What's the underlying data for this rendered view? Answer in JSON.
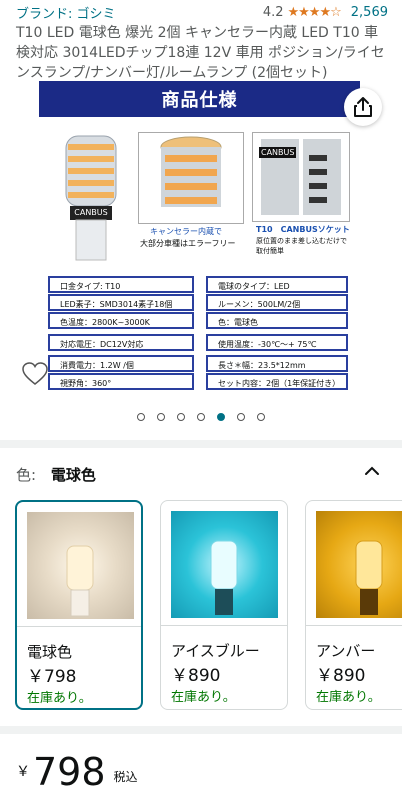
{
  "brand": {
    "text": "ブランド: ゴシミ"
  },
  "rating": {
    "value": "4.2",
    "stars": "★★★★☆",
    "count": "2,569"
  },
  "title": "T10 LED 電球色 爆光 2個 キャンセラー内蔵 LED T10 車検対応 3014LEDチップ18連 12V 車用 ポジション/ライセンスランプ/ナンバー灯/ルームランプ (2個セット)",
  "image": {
    "banner": "商品仕様",
    "canbus": "CANBUS",
    "caption_center_1": "キャンセラー内蔵で",
    "caption_center_2": "大部分車種はエラーフリー",
    "caption_right_1": "T10　CANBUSソケット",
    "caption_right_2": "原位置のまま差し込むだけで",
    "caption_right_3": "取付簡単",
    "specs_left": [
      "口金タイプ: T10",
      "LED素子：SMD3014素子18個",
      "色温度：2800K~3000K",
      "対応電圧：DC12V対応",
      "消費電力：1.2W /個",
      "視野角：360°"
    ],
    "specs_right": [
      "電球のタイプ：LED",
      "ルーメン：500LM/2個",
      "色：電球色",
      "使用温度：-30℃〜+ 75℃",
      "長さ＊幅：23.5*12mm",
      "セット内容：2個（1年保証付き）"
    ]
  },
  "carousel": {
    "count": 7,
    "active": 5
  },
  "color": {
    "label": "色:",
    "value": "電球色"
  },
  "variants": [
    {
      "name": "電球色",
      "price": "￥798",
      "stock": "在庫あり。"
    },
    {
      "name": "アイスブルー",
      "price": "￥890",
      "stock": "在庫あり。"
    },
    {
      "name": "アンバー",
      "price": "￥890",
      "stock": "在庫あり。"
    }
  ],
  "price": {
    "symbol": "￥",
    "value": "798",
    "tax": "税込"
  },
  "colors": {
    "link": "#007185",
    "star": "#de7921",
    "stock": "#007600",
    "banner": "#1b2a86"
  }
}
